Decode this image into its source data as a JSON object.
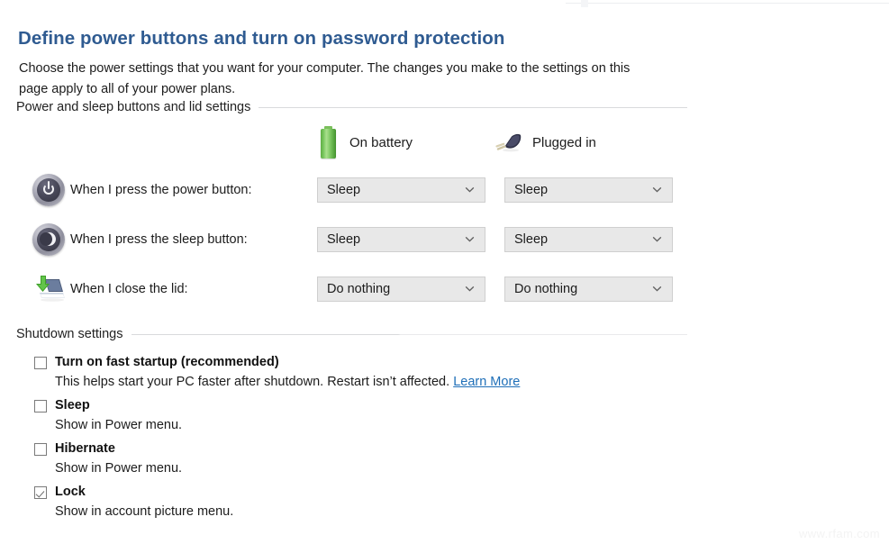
{
  "page": {
    "title": "Define power buttons and turn on password protection",
    "description": "Choose the power settings that you want for your computer. The changes you make to the settings on this page apply to all of your power plans.",
    "title_color": "#2f5b91"
  },
  "groups": {
    "power_lid": {
      "label": "Power and sleep buttons and lid settings"
    },
    "shutdown": {
      "label": "Shutdown settings"
    }
  },
  "columns": [
    {
      "id": "on_battery",
      "label": "On battery",
      "icon": "battery-icon"
    },
    {
      "id": "plugged_in",
      "label": "Plugged in",
      "icon": "plug-icon"
    }
  ],
  "settings_rows": [
    {
      "id": "power_button",
      "icon": "power-button-icon",
      "label": "When I press the power button:",
      "on_battery": "Sleep",
      "plugged_in": "Sleep"
    },
    {
      "id": "sleep_button",
      "icon": "sleep-button-icon",
      "label": "When I press the sleep button:",
      "on_battery": "Sleep",
      "plugged_in": "Sleep"
    },
    {
      "id": "close_lid",
      "icon": "laptop-lid-icon",
      "label": "When I close the lid:",
      "on_battery": "Do nothing",
      "plugged_in": "Do nothing"
    }
  ],
  "shutdown_options": [
    {
      "id": "fast_startup",
      "title": "Turn on fast startup (recommended)",
      "checked": false,
      "description": "This helps start your PC faster after shutdown. Restart isn’t affected.",
      "link": "Learn More"
    },
    {
      "id": "sleep",
      "title": "Sleep",
      "checked": false,
      "description": "Show in Power menu.",
      "link": ""
    },
    {
      "id": "hibernate",
      "title": "Hibernate",
      "checked": false,
      "description": "Show in Power menu.",
      "link": ""
    },
    {
      "id": "lock",
      "title": "Lock",
      "checked": true,
      "description": "Show in account picture menu.",
      "link": ""
    }
  ],
  "watermark": "www.rfam.com"
}
